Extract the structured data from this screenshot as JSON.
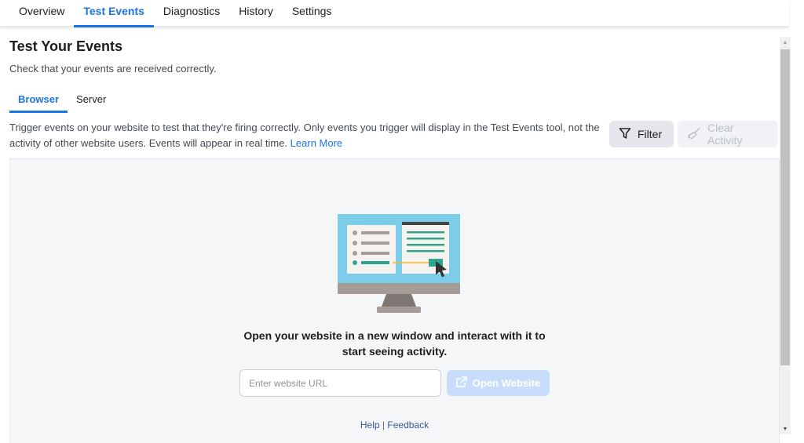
{
  "top_tabs": [
    {
      "label": "Overview"
    },
    {
      "label": "Test Events"
    },
    {
      "label": "Diagnostics"
    },
    {
      "label": "History"
    },
    {
      "label": "Settings"
    }
  ],
  "active_top_tab": "Test Events",
  "page": {
    "title": "Test Your Events",
    "subtitle": "Check that your events are received correctly."
  },
  "sub_tabs": [
    {
      "label": "Browser"
    },
    {
      "label": "Server"
    }
  ],
  "active_sub_tab": "Browser",
  "description": {
    "text": "Trigger events on your website to test that they're firing correctly. Only events you trigger will display in the Test Events tool, not the activity of other website users. Events will appear in real time.",
    "link": "Learn More"
  },
  "toolbar": {
    "filter_label": "Filter",
    "clear_label": "Clear Activity"
  },
  "empty_state": {
    "line1": "Open your website in a new window and interact with it to",
    "line2": "start seeing activity.",
    "url_placeholder": "Enter website URL",
    "url_value": "",
    "open_button": "Open Website"
  },
  "footer": {
    "help": "Help",
    "separator": "|",
    "feedback": "Feedback"
  },
  "icons": {
    "filter": "filter-funnel-icon",
    "clear": "broom-icon",
    "open": "external-link-icon"
  },
  "colors": {
    "accent": "#1b74e4",
    "disabled_button": "#c7ddfb",
    "monitor_screen": "#7ccde9",
    "monitor_stand": "#a59c98",
    "chart_green": "#2fa58b"
  }
}
